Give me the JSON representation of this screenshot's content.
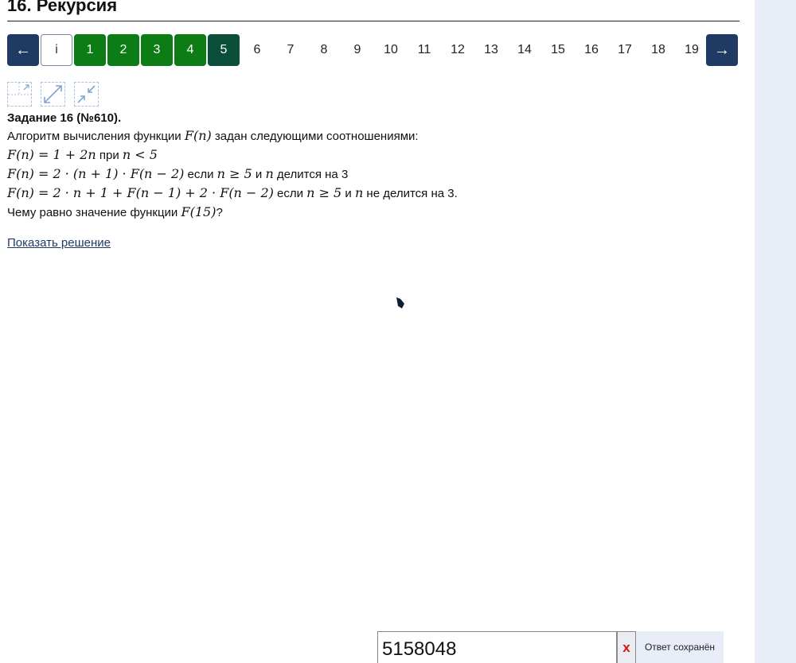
{
  "page": {
    "title": "16. Рекурсия"
  },
  "nav": {
    "prev_label": "←",
    "info_label": "i",
    "next_label": "→",
    "done_items": [
      "1",
      "2",
      "3",
      "4"
    ],
    "current_item": "5",
    "plain_items": [
      "6",
      "7",
      "8",
      "9",
      "10",
      "11",
      "12",
      "13",
      "14",
      "15",
      "16",
      "17",
      "18",
      "19"
    ]
  },
  "tools": {
    "icons": [
      "expand-left-icon",
      "expand-icon",
      "collapse-icon"
    ]
  },
  "task": {
    "header": "Задание 16 (№610).",
    "intro_before": "Алгоритм вычисления функции ",
    "intro_math": "F(n)",
    "intro_after": " задан следующими соотношениями:",
    "rule1_math": "F(n) = 1 + 2n",
    "rule1_text": " при ",
    "rule1_cond": "n < 5",
    "rule2_math": "F(n) = 2 · (n + 1) · F(n − 2)",
    "rule2_text1": " если ",
    "rule2_cond1": "n ≥ 5",
    "rule2_text2": " и ",
    "rule2_cond2": "n",
    "rule2_text3": " делится на 3",
    "rule3_math": "F(n) = 2 · n + 1 + F(n − 1) + 2 · F(n − 2)",
    "rule3_text1": " если ",
    "rule3_cond1": "n ≥ 5",
    "rule3_text2": " и ",
    "rule3_cond2": "n",
    "rule3_text3": " не делится на 3.",
    "question_before": "Чему равно значение функции ",
    "question_math": "F(15)",
    "question_after": "?"
  },
  "solution_link": "Показать решение",
  "answer": {
    "value": "5158048",
    "clear_label": "x",
    "status": "Ответ сохранён"
  },
  "colors": {
    "arrow_bg": "#1f3a63",
    "done_bg": "#0b7d14",
    "current_bg": "#0b4f3a",
    "side_panel": "#e8edf7"
  }
}
